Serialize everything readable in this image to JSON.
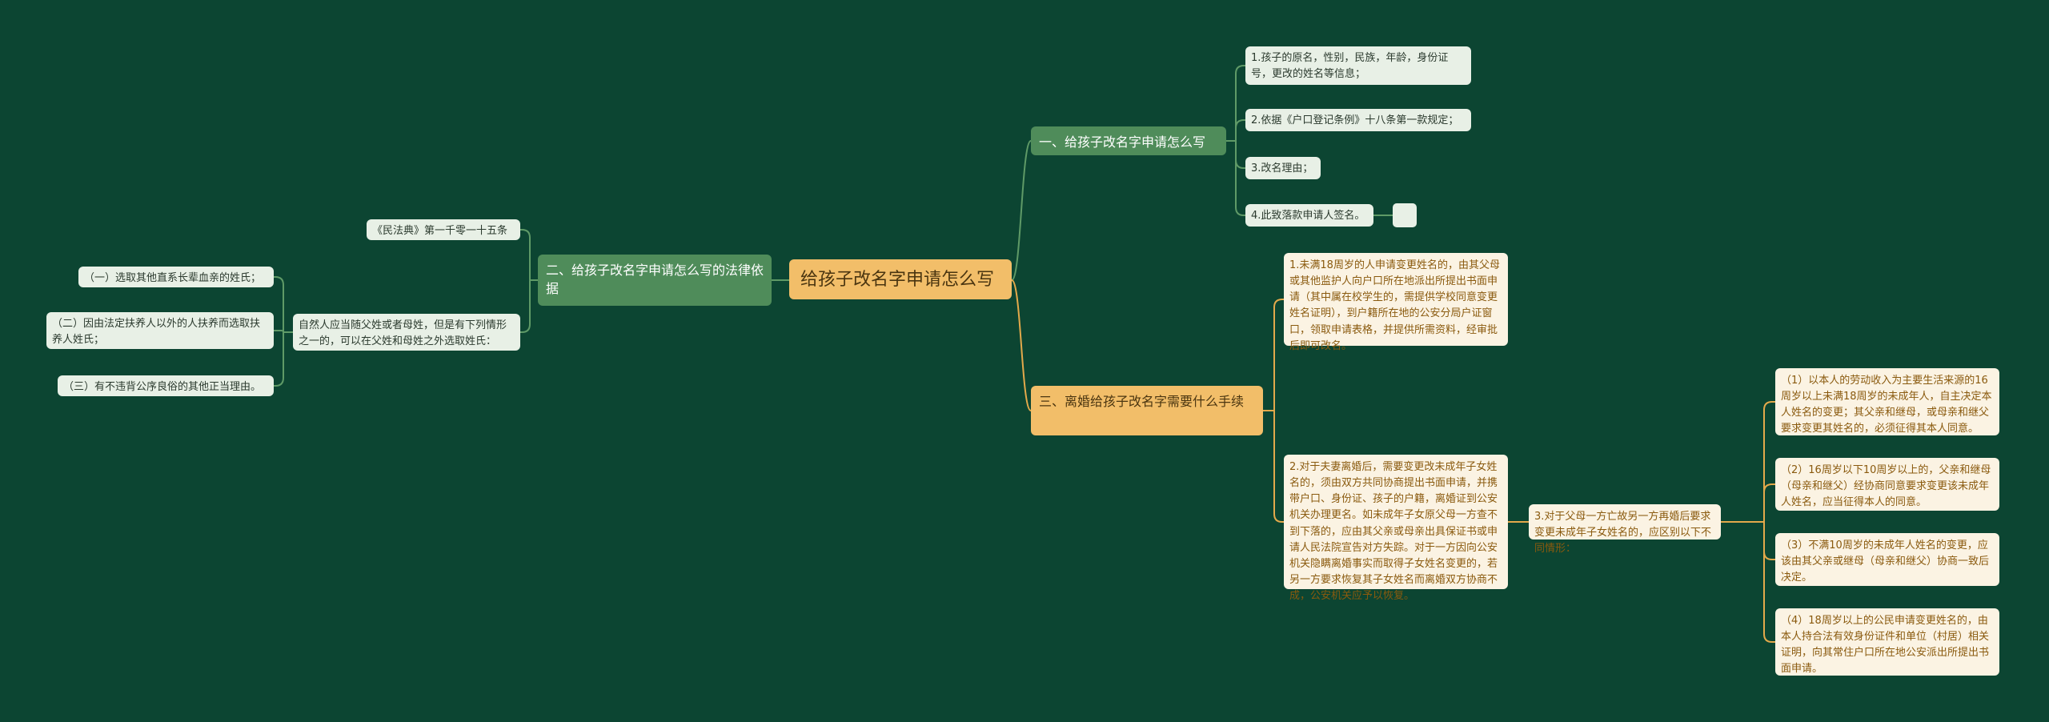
{
  "root": "给孩子改名字申请怎么写",
  "branch1": {
    "title": "一、给孩子改名字申请怎么写",
    "items": [
      "1.孩子的原名，性别，民族，年龄，身份证号，更改的姓名等信息；",
      "2.依据《户口登记条例》十八条第一款规定；",
      "3.改名理由；",
      "4.此致落款申请人签名。"
    ]
  },
  "branch2": {
    "title": "二、给孩子改名字申请怎么写的法律依据",
    "law": "《民法典》第一千零一十五条",
    "rule": "自然人应当随父姓或者母姓，但是有下列情形之一的，可以在父姓和母姓之外选取姓氏：",
    "items": [
      "（一）选取其他直系长辈血亲的姓氏；",
      "（二）因由法定扶养人以外的人扶养而选取扶养人姓氏；",
      "（三）有不违背公序良俗的其他正当理由。"
    ]
  },
  "branch3": {
    "title": "三、离婚给孩子改名字需要什么手续",
    "item1": "1.未满18周岁的人申请变更姓名的，由其父母或其他监护人向户口所在地派出所提出书面申请（其中属在校学生的，需提供学校同意变更姓名证明），到户籍所在地的公安分局户证窗口，领取申请表格，并提供所需资料，经审批后即可改名。",
    "item2": "2.对于夫妻离婚后，需要变更改未成年子女姓名的，须由双方共同协商提出书面申请，并携带户口、身份证、孩子的户籍，离婚证到公安机关办理更名。如未成年子女原父母一方查不到下落的，应由其父亲或母亲出具保证书或申请人民法院宣告对方失踪。对于一方因向公安机关隐瞒离婚事实而取得子女姓名变更的，若另一方要求恢复其子女姓名而离婚双方协商不成，公安机关应予以恢复。",
    "item3": "3.对于父母一方亡故另一方再婚后要求变更未成年子女姓名的，应区别以下不同情形：",
    "sub": [
      "（1）以本人的劳动收入为主要生活来源的16周岁以上未满18周岁的未成年人，自主决定本人姓名的变更；其父亲和继母，或母亲和继父要求变更其姓名的，必须征得其本人同意。",
      "（2）16周岁以下10周岁以上的，父亲和继母（母亲和继父）经协商同意要求变更该未成年人姓名，应当征得本人的同意。",
      "（3）不满10周岁的未成年人姓名的变更，应该由其父亲或继母（母亲和继父）协商一致后决定。",
      "（4）18周岁以上的公民申请变更姓名的，由本人持合法有效身份证件和单位（村居）相关证明，向其常住户口所在地公安派出所提出书面申请。"
    ]
  },
  "colors": {
    "background": "#0c4532",
    "root": "#f2be69",
    "green_branch": "#4f8c5a",
    "green_leaf": "#e8f0e6",
    "orange_leaf": "#fbf3e3",
    "orange_leaf_text": "#8a5a0e"
  }
}
